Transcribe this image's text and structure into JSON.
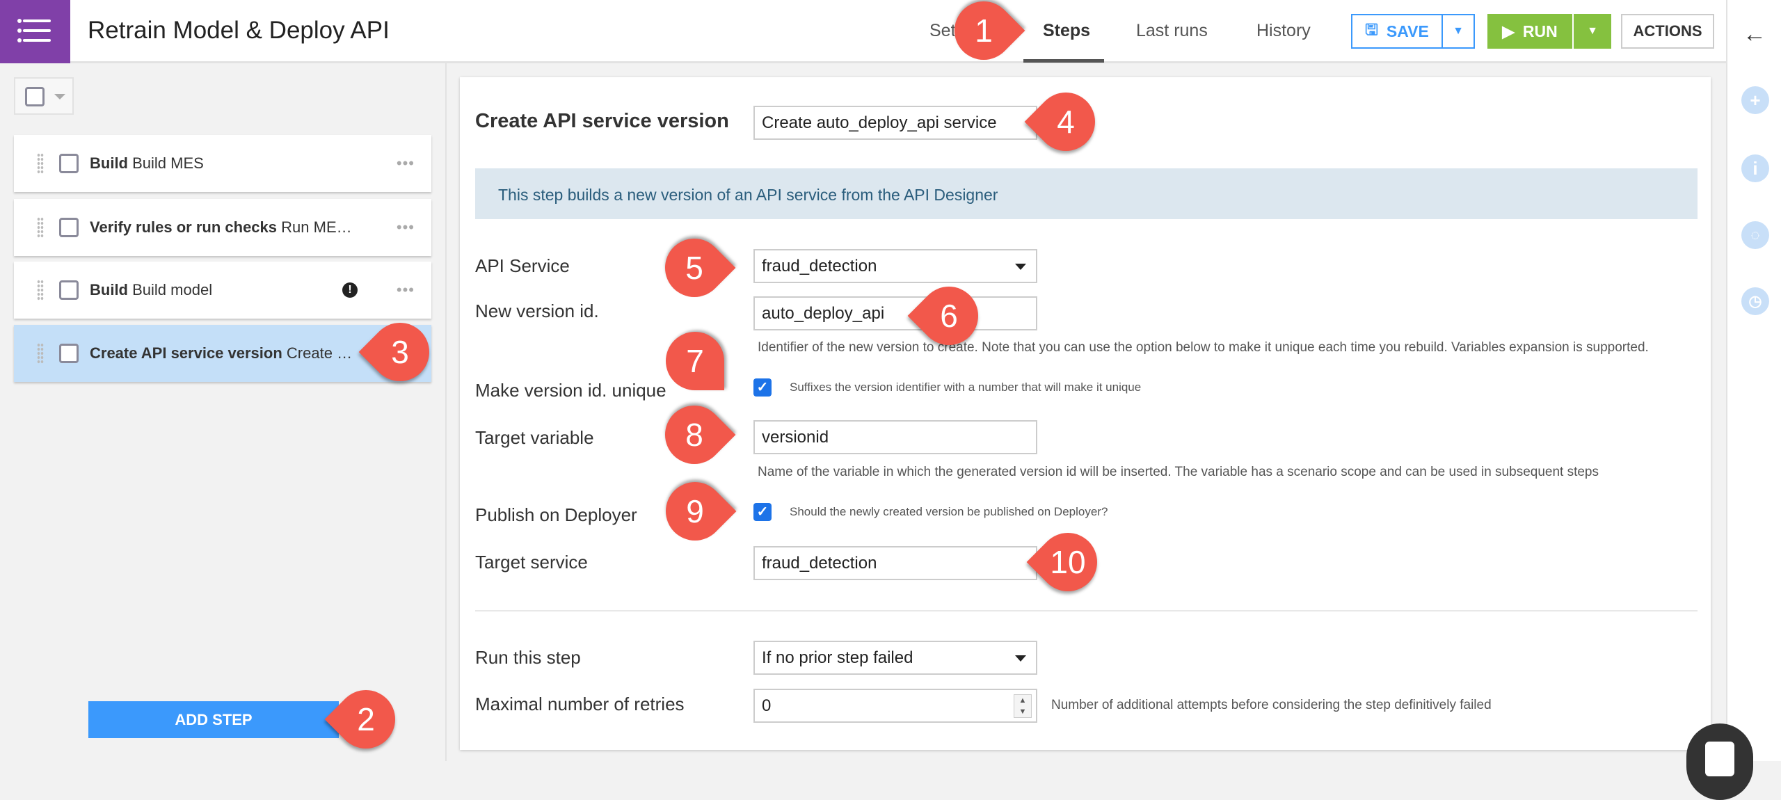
{
  "header": {
    "title": "Retrain Model & Deploy API",
    "tabs": [
      {
        "label": "Settings"
      },
      {
        "label": "Steps"
      },
      {
        "label": "Last runs"
      },
      {
        "label": "History"
      }
    ],
    "save_label": "SAVE",
    "run_label": "RUN",
    "actions_label": "ACTIONS"
  },
  "steps": [
    {
      "type": "Build",
      "name": "Build MES"
    },
    {
      "type": "Verify rules or run checks",
      "name": "Run ME…"
    },
    {
      "type": "Build",
      "name": "Build model",
      "warning": true
    },
    {
      "type": "Create API service version",
      "name": "Create …",
      "selected": true
    }
  ],
  "add_step_label": "ADD STEP",
  "form": {
    "section_title": "Create API service version",
    "step_name": "Create auto_deploy_api service",
    "banner": "This step builds a new version of an API service from the API Designer",
    "api_service_label": "API Service",
    "api_service_value": "fraud_detection",
    "version_id_label": "New version id.",
    "version_id_value": "auto_deploy_api",
    "version_id_help": "Identifier of the new version to create. Note that you can use the option below to make it unique each time you rebuild. Variables expansion is supported.",
    "unique_label": "Make version id. unique",
    "unique_help": "Suffixes the version identifier with a number that will make it unique",
    "unique_checked": true,
    "target_var_label": "Target variable",
    "target_var_value": "versionid",
    "target_var_help": "Name of the variable in which the generated version id will be inserted. The variable has a scenario scope and can be used in subsequent steps",
    "publish_label": "Publish on Deployer",
    "publish_help": "Should the newly created version be published on Deployer?",
    "publish_checked": true,
    "target_service_label": "Target service",
    "target_service_value": "fraud_detection",
    "run_step_label": "Run this step",
    "run_step_value": "If no prior step failed",
    "retries_label": "Maximal number of retries",
    "retries_value": "0",
    "retries_help": "Number of additional attempts before considering the step definitively failed"
  },
  "callouts": [
    "1",
    "2",
    "3",
    "4",
    "5",
    "6",
    "7",
    "8",
    "9",
    "10"
  ],
  "colors": {
    "brand": "#8040a8",
    "save": "#3b99fc",
    "run": "#85c13f",
    "callout": "#f2584b"
  }
}
